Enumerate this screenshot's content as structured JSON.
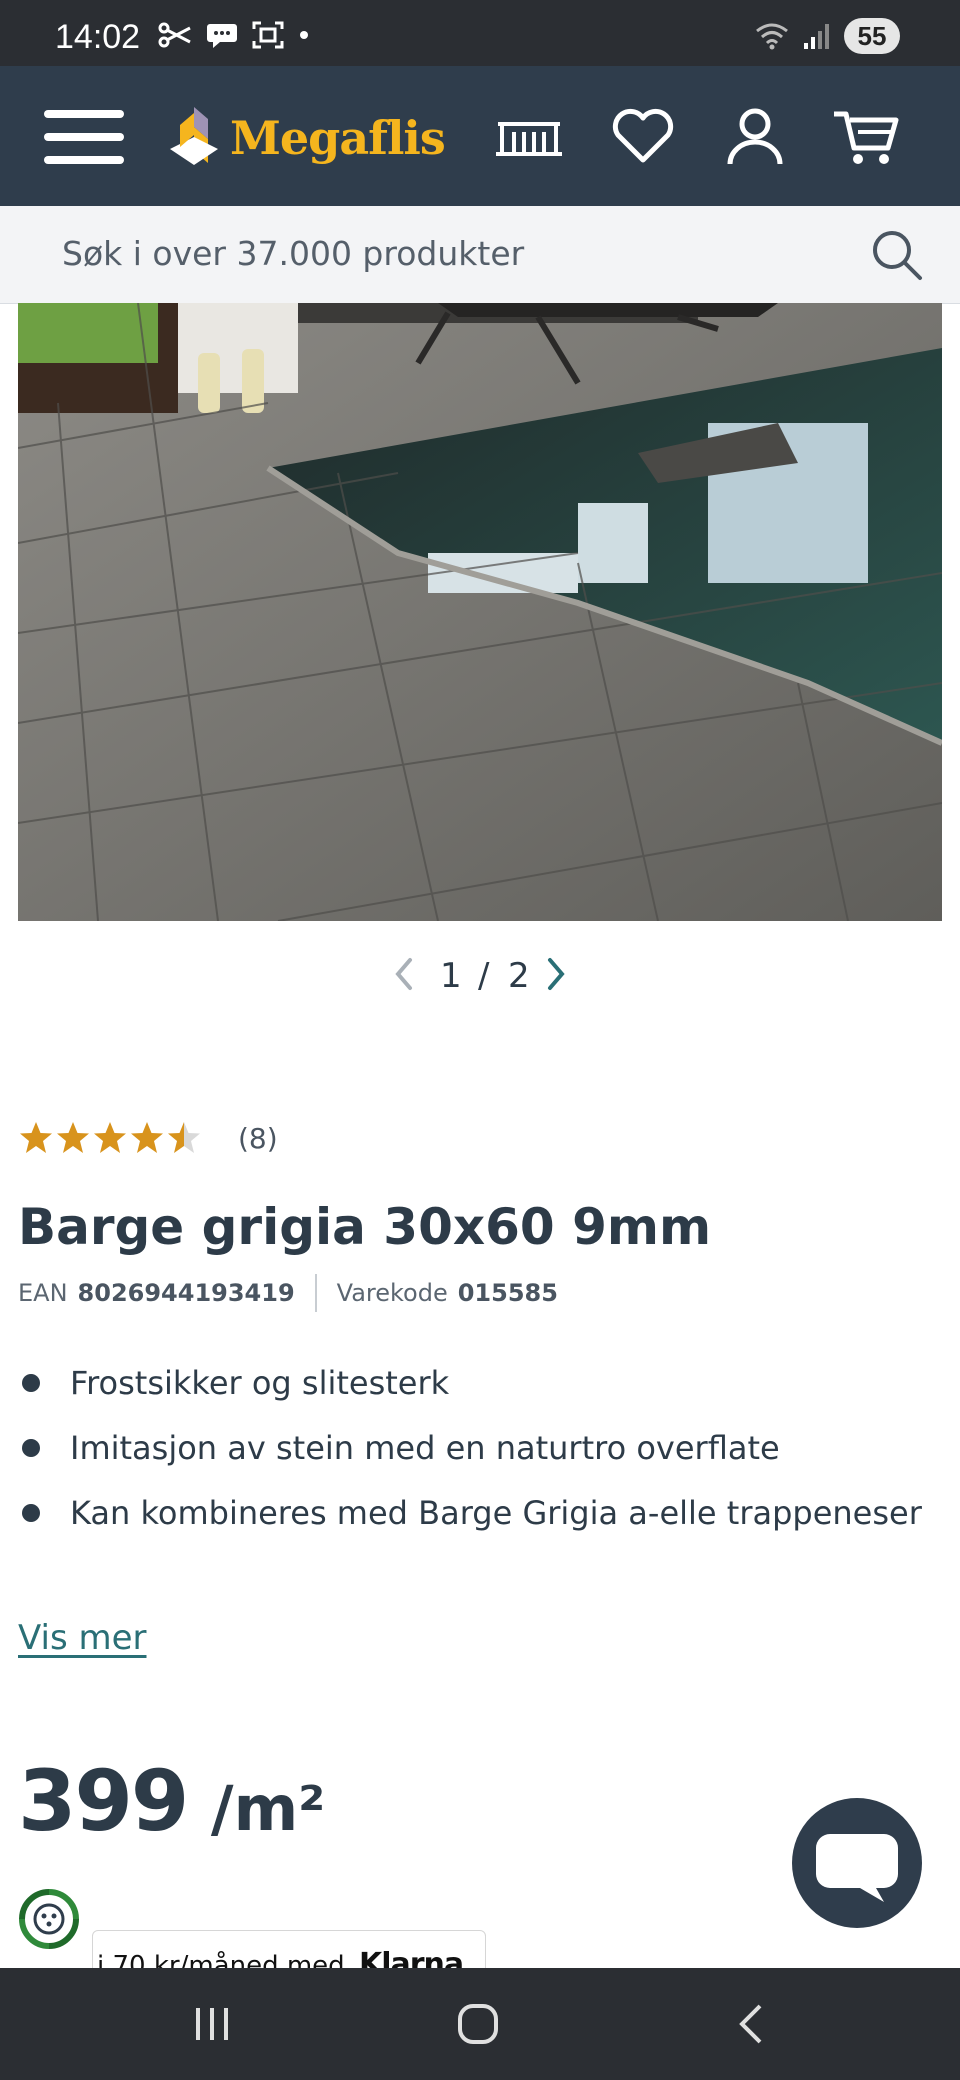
{
  "status_bar": {
    "time": "14:02",
    "battery": "55"
  },
  "header": {
    "brand": "Megaflis",
    "accent_color": "#f5b51e",
    "background_color": "#2f3d4c",
    "icons": [
      "menu-icon",
      "showroom-icon",
      "heart-icon",
      "user-icon",
      "cart-icon"
    ]
  },
  "search": {
    "placeholder": "Søk i over 37.000 produkter"
  },
  "gallery": {
    "current": "1",
    "separator": "/",
    "total": "2"
  },
  "product": {
    "rating": 4.5,
    "review_count": "(8)",
    "title": "Barge grigia 30x60 9mm",
    "ean_label": "EAN",
    "ean": "8026944193419",
    "sku_label": "Varekode",
    "sku": "015585",
    "features": [
      "Frostsikker og slitesterk",
      "Imitasjon av stein med en naturtro overflate",
      "Kan kombineres med Barge Grigia a-elle trappeneser"
    ],
    "show_more": "Vis mer",
    "price": "399",
    "price_unit": "/m²"
  },
  "klarna": {
    "text": "i 70 kr/måned med",
    "brand": "Klarna"
  }
}
